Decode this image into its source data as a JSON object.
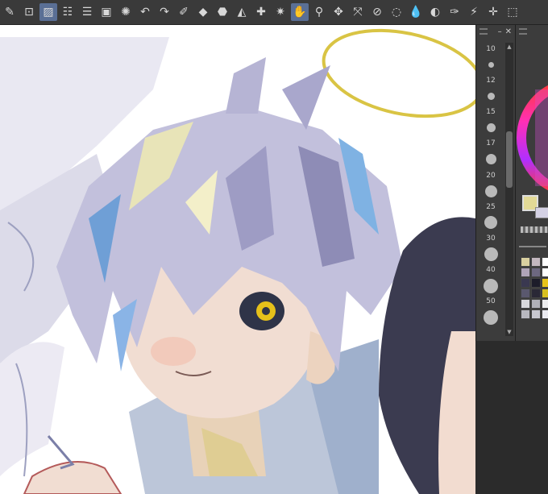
{
  "toolbar": {
    "tools": [
      {
        "icon": "pen-icon",
        "glyph": "✎"
      },
      {
        "icon": "layer-transfer-icon",
        "glyph": "⊡"
      },
      {
        "icon": "layer-mask-icon",
        "glyph": "▨",
        "active": true
      },
      {
        "icon": "layer-settings-icon",
        "glyph": "☷"
      },
      {
        "icon": "layer-list-icon",
        "glyph": "☰"
      },
      {
        "icon": "canvas-icon",
        "glyph": "▣"
      },
      {
        "icon": "loading-spinner-icon",
        "glyph": "✺"
      },
      {
        "icon": "undo-icon",
        "glyph": "↶"
      },
      {
        "icon": "redo-icon",
        "glyph": "↷"
      },
      {
        "icon": "pen-tool-icon",
        "glyph": "✐"
      },
      {
        "icon": "eraser-icon",
        "glyph": "◆"
      },
      {
        "icon": "fill-brush-icon",
        "glyph": "⬣"
      },
      {
        "icon": "fill-bucket-icon",
        "glyph": "◭"
      },
      {
        "icon": "sparkle-icon",
        "glyph": "✚"
      },
      {
        "icon": "star-burst-icon",
        "glyph": "✷"
      },
      {
        "icon": "hand-icon",
        "glyph": "✋",
        "active": true
      },
      {
        "icon": "zoom-icon",
        "glyph": "⚲"
      },
      {
        "icon": "move-layer-icon",
        "glyph": "✥"
      },
      {
        "icon": "transform-icon",
        "glyph": "⤧"
      },
      {
        "icon": "selection-off-icon",
        "glyph": "⊘"
      },
      {
        "icon": "lasso-icon",
        "glyph": "◌"
      },
      {
        "icon": "water-drop-icon",
        "glyph": "💧"
      },
      {
        "icon": "blend-icon",
        "glyph": "◐"
      },
      {
        "icon": "pen-outline-icon",
        "glyph": "✑"
      },
      {
        "icon": "magic-wand-icon",
        "glyph": "⚡"
      },
      {
        "icon": "plus-crosshair-icon",
        "glyph": "✛"
      },
      {
        "icon": "marquee-select-icon",
        "glyph": "⬚"
      }
    ]
  },
  "brush_size": {
    "labels": [
      "10",
      "12",
      "15",
      "17",
      "20",
      "25",
      "30",
      "40",
      "50"
    ]
  },
  "colors": {
    "canvas_bg": "#ffffff",
    "hair": "#b8b6d6",
    "hair_shadow": "#8a88b0",
    "skin": "#f1ddd2",
    "eye": "#e6c11a",
    "halo": "#d8c13a",
    "dark_hair": "#3a3a4e",
    "main_color": "#e2d996"
  }
}
